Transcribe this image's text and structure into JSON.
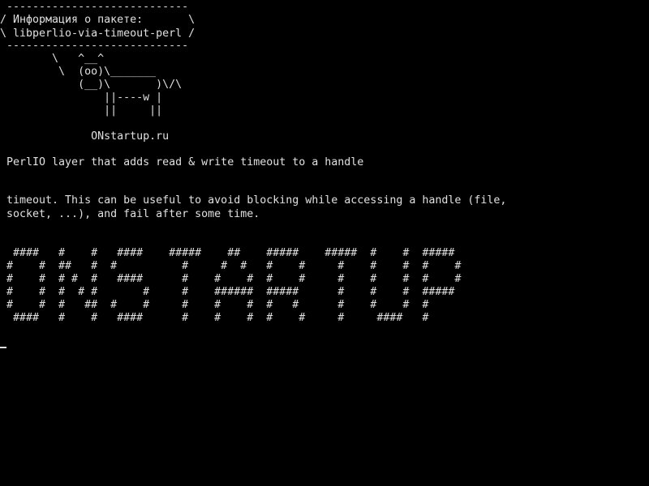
{
  "colors": {
    "background": "#000000",
    "foreground": "#e0e0e0"
  },
  "terminal": {
    "cowsay": {
      "bubble_top": " ----------------------------",
      "bubble_line1": "/ Информация о пакете:       \\",
      "bubble_line2": "\\ libperlio-via-timeout-perl /",
      "bubble_bottom": " ----------------------------",
      "cow_line1": "        \\   ^__^",
      "cow_line2": "         \\  (oo)\\_______",
      "cow_line3": "            (__)\\       )\\/\\",
      "cow_line4": "                ||----w |",
      "cow_line5": "                ||     ||"
    },
    "site": "              ONstartup.ru",
    "summary": " PerlIO layer that adds read & write timeout to a handle",
    "description_line1": " timeout. This can be useful to avoid blocking while accessing a handle (file,",
    "description_line2": " socket, ...), and fail after some time.",
    "banner": {
      "line1": "  ####   #    #   ####    #####    ##    #####    #####  #    #  #####",
      "line2": " #    #  ##   #  #          #     #  #   #    #     #    #    #  #    #",
      "line3": " #    #  # #  #   ####      #    #    #  #    #     #    #    #  #    #",
      "line4": " #    #  #  # #       #     #    ######  #####      #    #    #  #####",
      "line5": " #    #  #   ##  #    #     #    #    #  #   #      #    #    #  #",
      "line6": "  ####   #    #   ####      #    #    #  #    #     #     ####   #"
    }
  }
}
